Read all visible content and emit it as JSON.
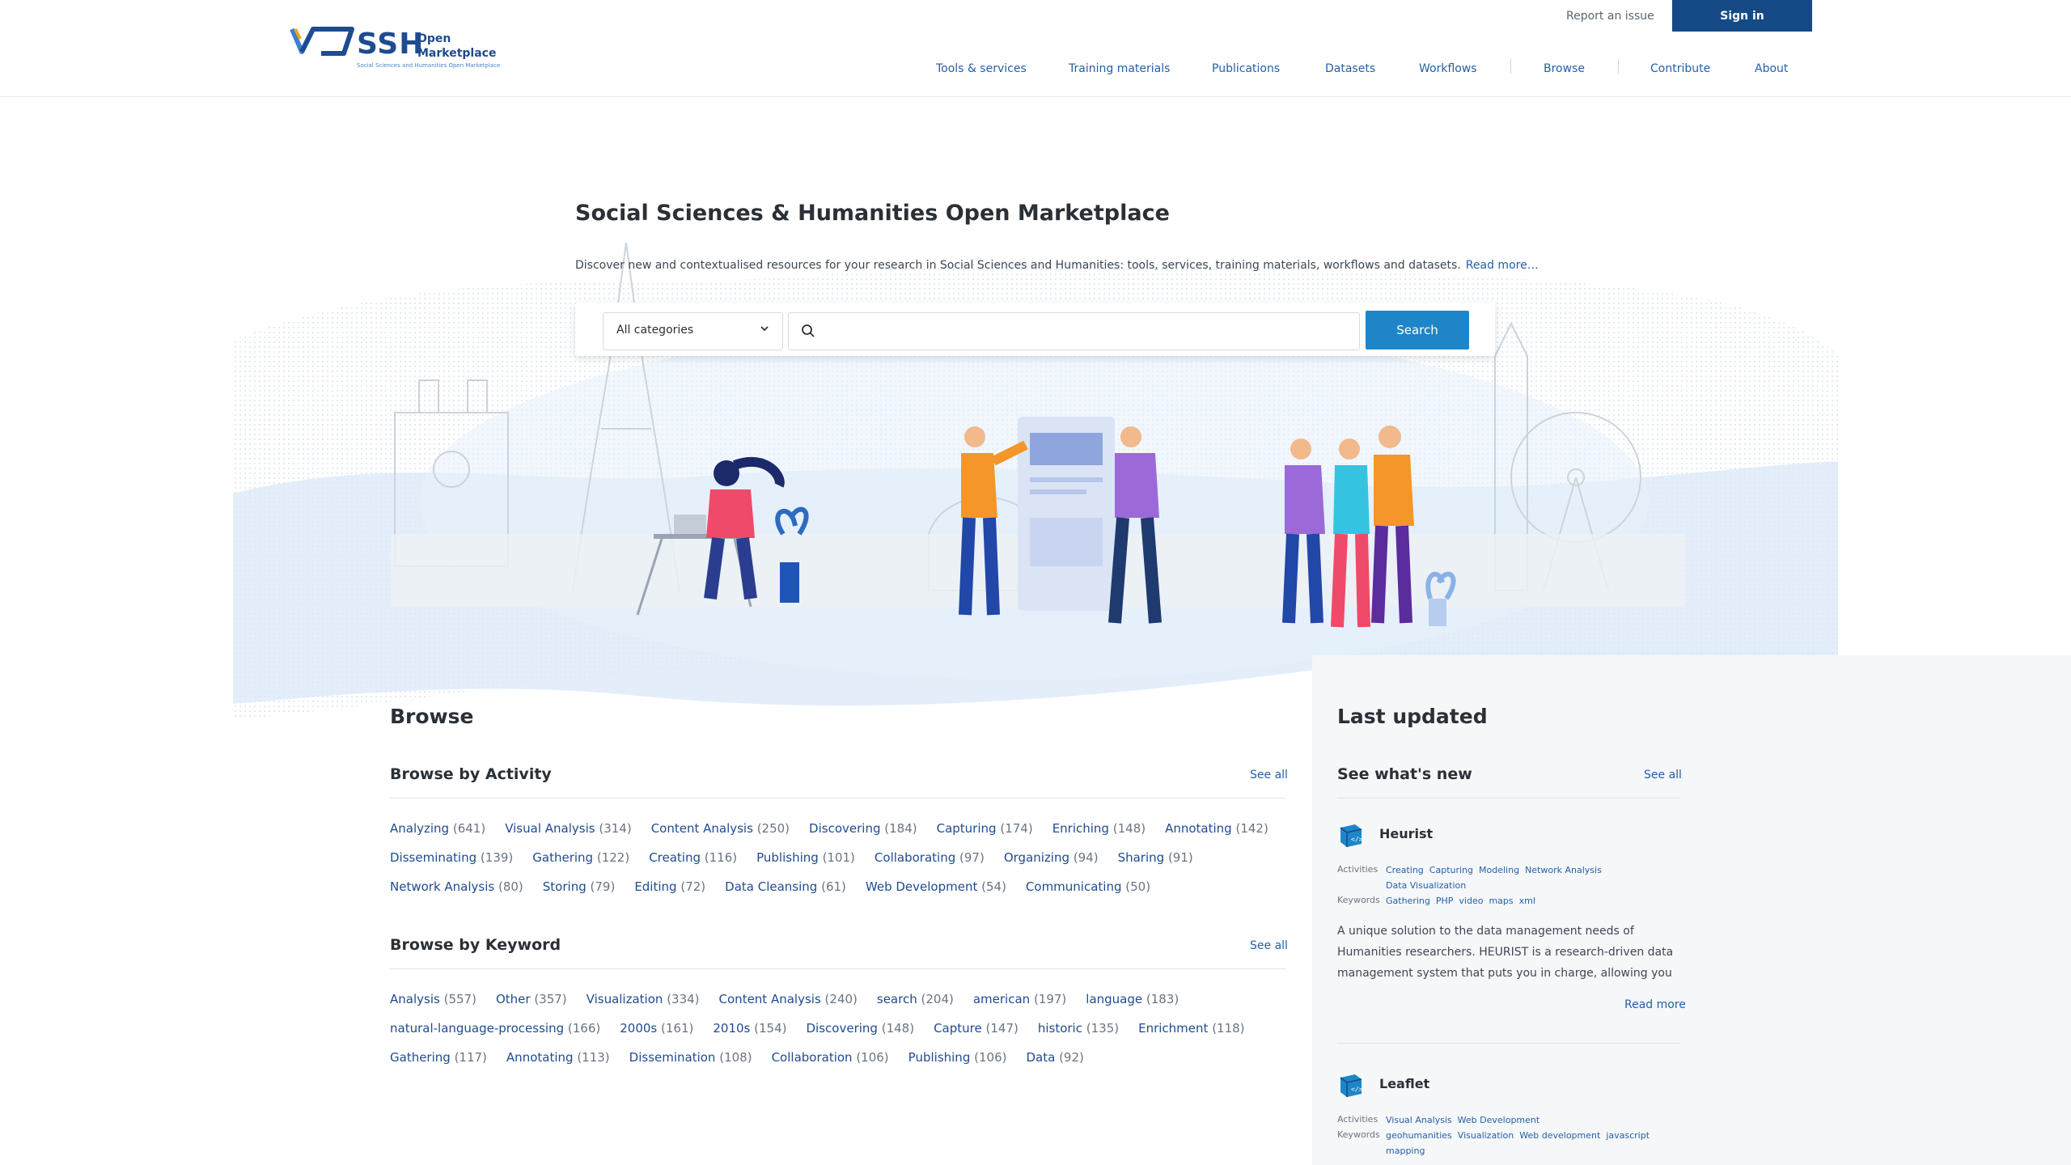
{
  "header": {
    "logo_text": "SSH",
    "logo_sub1": "Open",
    "logo_sub2": "Marketplace",
    "logo_tagline": "Social Sciences and Humanities Open Marketplace",
    "report_issue": "Report an issue",
    "sign_in": "Sign in",
    "nav": [
      "Tools & services",
      "Training materials",
      "Publications",
      "Datasets",
      "Workflows",
      "Browse",
      "Contribute",
      "About"
    ],
    "accent_color": "#154a86"
  },
  "hero": {
    "title": "Social Sciences & Humanities Open Marketplace",
    "intro": "Discover new and contextualised resources for your research in Social Sciences and Humanities: tools, services, training materials, workflows and datasets.",
    "read_more": "Read more…",
    "category_select": "All categories",
    "search_placeholder": "",
    "search_button": "Search",
    "button_color": "#1e86c8"
  },
  "browse": {
    "title": "Browse",
    "activity": {
      "title": "Browse by Activity",
      "see_all": "See all",
      "items": [
        {
          "name": "Analyzing",
          "count": "(641)"
        },
        {
          "name": "Visual Analysis",
          "count": "(314)"
        },
        {
          "name": "Content Analysis",
          "count": "(250)"
        },
        {
          "name": "Discovering",
          "count": "(184)"
        },
        {
          "name": "Capturing",
          "count": "(174)"
        },
        {
          "name": "Enriching",
          "count": "(148)"
        },
        {
          "name": "Annotating",
          "count": "(142)"
        },
        {
          "name": "Disseminating",
          "count": "(139)"
        },
        {
          "name": "Gathering",
          "count": "(122)"
        },
        {
          "name": "Creating",
          "count": "(116)"
        },
        {
          "name": "Publishing",
          "count": "(101)"
        },
        {
          "name": "Collaborating",
          "count": "(97)"
        },
        {
          "name": "Organizing",
          "count": "(94)"
        },
        {
          "name": "Sharing",
          "count": "(91)"
        },
        {
          "name": "Network Analysis",
          "count": "(80)"
        },
        {
          "name": "Storing",
          "count": "(79)"
        },
        {
          "name": "Editing",
          "count": "(72)"
        },
        {
          "name": "Data Cleansing",
          "count": "(61)"
        },
        {
          "name": "Web Development",
          "count": "(54)"
        },
        {
          "name": "Communicating",
          "count": "(50)"
        }
      ]
    },
    "keyword": {
      "title": "Browse by Keyword",
      "see_all": "See all",
      "items": [
        {
          "name": "Analysis",
          "count": "(557)"
        },
        {
          "name": "Other",
          "count": "(357)"
        },
        {
          "name": "Visualization",
          "count": "(334)"
        },
        {
          "name": "Content Analysis",
          "count": "(240)"
        },
        {
          "name": "search",
          "count": "(204)"
        },
        {
          "name": "american",
          "count": "(197)"
        },
        {
          "name": "language",
          "count": "(183)"
        },
        {
          "name": "natural-language-processing",
          "count": "(166)"
        },
        {
          "name": "2000s",
          "count": "(161)"
        },
        {
          "name": "2010s",
          "count": "(154)"
        },
        {
          "name": "Discovering",
          "count": "(148)"
        },
        {
          "name": "Capture",
          "count": "(147)"
        },
        {
          "name": "historic",
          "count": "(135)"
        },
        {
          "name": "Enrichment",
          "count": "(118)"
        },
        {
          "name": "Gathering",
          "count": "(117)"
        },
        {
          "name": "Annotating",
          "count": "(113)"
        },
        {
          "name": "Dissemination",
          "count": "(108)"
        },
        {
          "name": "Collaboration",
          "count": "(106)"
        },
        {
          "name": "Publishing",
          "count": "(106)"
        },
        {
          "name": "Data",
          "count": "(92)"
        }
      ]
    }
  },
  "last_updated": {
    "title": "Last updated",
    "subtitle": "See what's new",
    "see_all": "See all",
    "activities_label": "Activities",
    "keywords_label": "Keywords",
    "read_more": "Read more",
    "items": [
      {
        "name": "Heurist",
        "activities": [
          "Creating",
          "Capturing",
          "Modeling",
          "Network Analysis",
          "Data Visualization"
        ],
        "keywords": [
          "Gathering",
          "PHP",
          "video",
          "maps",
          "xml"
        ],
        "description": "A unique solution to the data management needs of Humanities researchers. HEURIST is a research-driven data management system that puts you in charge, allowing you t…"
      },
      {
        "name": "Leaflet",
        "activities": [
          "Visual Analysis",
          "Web Development"
        ],
        "keywords": [
          "geohumanities",
          "Visualization",
          "Web development",
          "javascript",
          "mapping"
        ]
      }
    ]
  }
}
